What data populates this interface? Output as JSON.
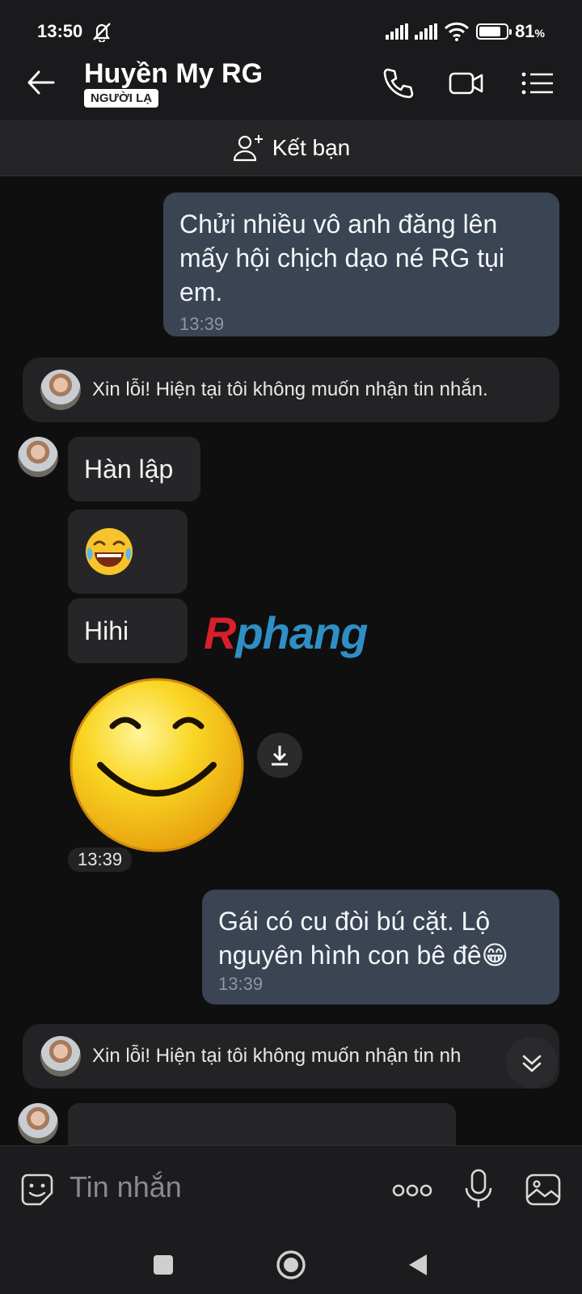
{
  "status_bar": {
    "time": "13:50",
    "battery_percent": "81",
    "battery_unit": "%",
    "battery_level": 0.81
  },
  "header": {
    "name": "Huyền My RG",
    "badge": "NGƯỜI LẠ"
  },
  "friend_bar": {
    "label": "Kết bạn"
  },
  "messages": {
    "out1": {
      "text_lines": [
        "Chửi nhiều vô anh đăng lên",
        "mấy hội chịch dạo né RG tụi",
        "em."
      ],
      "time": "13:39"
    },
    "notice1": {
      "text": "Xin lỗi! Hiện tại tôi không muốn nhận tin nhắn."
    },
    "in1": {
      "text": "Hàn lập"
    },
    "in2": {
      "emoji": "😂"
    },
    "in3": {
      "text": "Hihi"
    },
    "sticker_time": "13:39",
    "out2": {
      "text_lines": [
        "Gái có cu đòi bú cặt. Lộ",
        "nguyên hình con bê đê😁"
      ],
      "time": "13:39"
    },
    "notice2": {
      "text": "Xin lỗi! Hiện tại tôi không muốn nhận tin nh"
    }
  },
  "watermark": {
    "first": "R",
    "rest": "phang"
  },
  "input": {
    "placeholder": "Tin nhắn"
  },
  "icons": [
    "muted-bell-icon",
    "signal-icon",
    "wifi-icon",
    "battery-icon",
    "back-arrow-icon",
    "phone-icon",
    "video-call-icon",
    "menu-icon",
    "add-friend-icon",
    "download-icon",
    "scroll-down-icon",
    "sticker-icon",
    "more-icon",
    "microphone-icon",
    "image-icon",
    "nav-recent-icon",
    "nav-home-icon",
    "nav-back-icon"
  ],
  "colors": {
    "background": "#0f0f10",
    "outgoing_bubble": "#3a4452",
    "incoming_bubble": "#262628"
  }
}
